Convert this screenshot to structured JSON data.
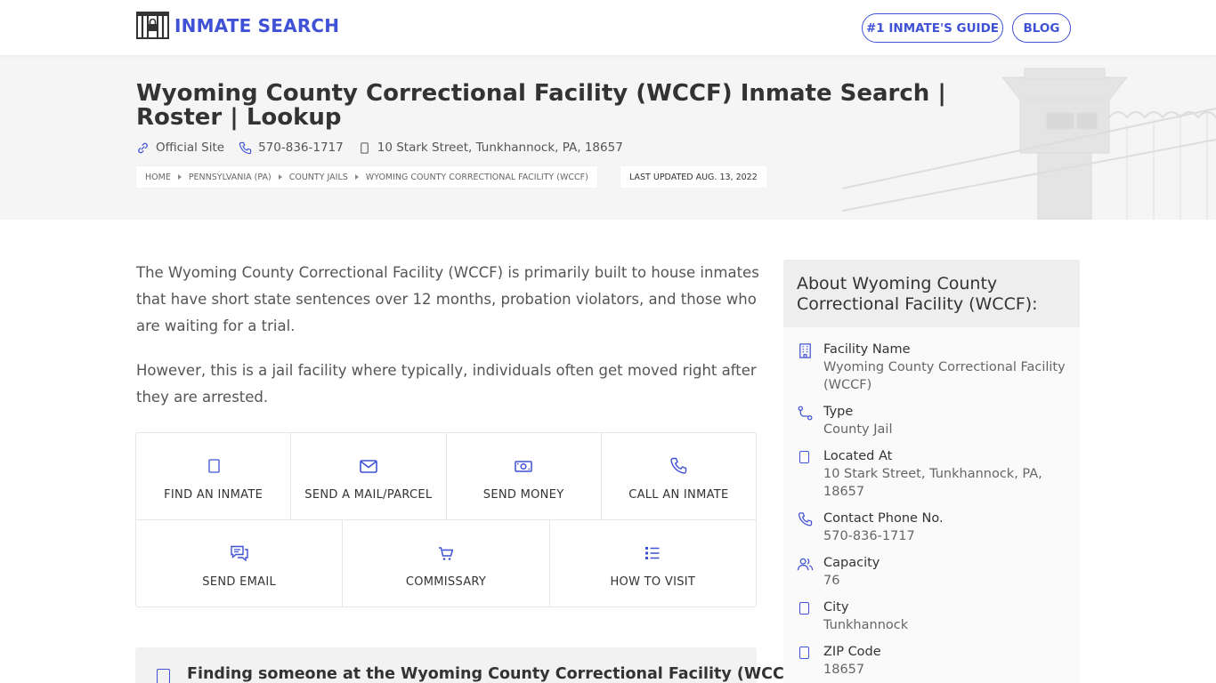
{
  "header": {
    "logo_text": "INMATE SEARCH",
    "nav": [
      {
        "label": "#1 INMATE'S GUIDE"
      },
      {
        "label": "BLOG"
      }
    ]
  },
  "hero": {
    "title": "Wyoming County Correctional Facility (WCCF) Inmate Search | Roster | Lookup",
    "official_site": "Official Site",
    "phone": "570-836-1717",
    "address": "10 Stark Street, Tunkhannock, PA, 18657",
    "breadcrumbs": [
      "HOME",
      "PENNSYLVANIA (PA)",
      "COUNTY JAILS",
      "WYOMING COUNTY CORRECTIONAL FACILITY (WCCF)"
    ],
    "last_updated": "LAST UPDATED AUG. 13, 2022"
  },
  "intro": {
    "p1": "The Wyoming County Correctional Facility (WCCF) is primarily built to house inmates that have short state sentences over 12 months, probation violators, and those who are waiting for a trial.",
    "p2": "However, this is a jail facility where typically, individuals often get moved right after they are arrested."
  },
  "actions": {
    "row1": [
      "FIND AN INMATE",
      "SEND A MAIL/PARCEL",
      "SEND MONEY",
      "CALL AN INMATE"
    ],
    "row2": [
      "SEND EMAIL",
      "COMMISSARY",
      "HOW TO VISIT"
    ]
  },
  "faq": {
    "title": "Finding someone at the Wyoming County Correctional Facility (WCCF)"
  },
  "about": {
    "title": "About Wyoming County Correctional Facility (WCCF):",
    "facts": [
      {
        "label": "Facility Name",
        "value": "Wyoming County Correctional Facility (WCCF)"
      },
      {
        "label": "Type",
        "value": "County Jail"
      },
      {
        "label": "Located At",
        "value": "10 Stark Street, Tunkhannock, PA, 18657"
      },
      {
        "label": "Contact Phone No.",
        "value": "570-836-1717"
      },
      {
        "label": "Capacity",
        "value": "76"
      },
      {
        "label": "City",
        "value": "Tunkhannock"
      },
      {
        "label": "ZIP Code",
        "value": "18657"
      }
    ]
  },
  "colors": {
    "accent": "#3f51d4",
    "hero_bg": "#f5f5f5"
  }
}
